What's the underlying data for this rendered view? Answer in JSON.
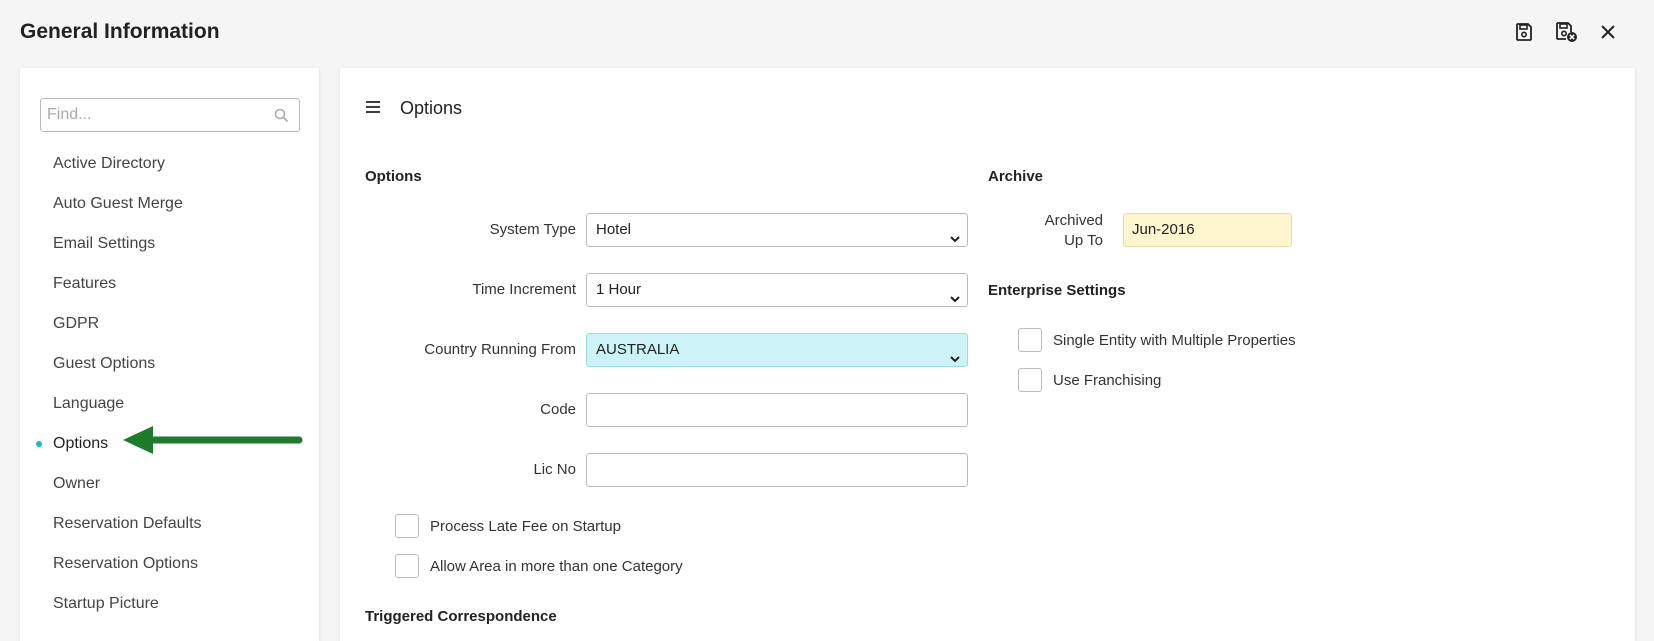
{
  "header": {
    "title": "General Information",
    "actions": [
      {
        "name": "save-icon"
      },
      {
        "name": "save-close-icon"
      },
      {
        "name": "close-icon"
      }
    ]
  },
  "sidebar": {
    "search_placeholder": "Find...",
    "items": [
      {
        "label": "Active Directory"
      },
      {
        "label": "Auto Guest Merge"
      },
      {
        "label": "Email Settings"
      },
      {
        "label": "Features"
      },
      {
        "label": "GDPR"
      },
      {
        "label": "Guest Options"
      },
      {
        "label": "Language"
      },
      {
        "label": "Options",
        "active": true
      },
      {
        "label": "Owner"
      },
      {
        "label": "Reservation Defaults"
      },
      {
        "label": "Reservation Options"
      },
      {
        "label": "Startup Picture"
      }
    ]
  },
  "main": {
    "title": "Options",
    "options_section": {
      "heading": "Options",
      "system_type": {
        "label": "System Type",
        "value": "Hotel"
      },
      "time_increment": {
        "label": "Time Increment",
        "value": "1 Hour"
      },
      "country": {
        "label": "Country Running From",
        "value": "AUSTRALIA"
      },
      "code": {
        "label": "Code",
        "value": ""
      },
      "lic_no": {
        "label": "Lic No",
        "value": ""
      },
      "process_late_fee": {
        "label": "Process Late Fee on Startup",
        "checked": false
      },
      "allow_area": {
        "label": "Allow Area in more than one Category",
        "checked": false
      }
    },
    "archive_section": {
      "heading": "Archive",
      "archived_up_to": {
        "label_line1": "Archived",
        "label_line2": "Up To",
        "value": "Jun-2016"
      }
    },
    "enterprise_section": {
      "heading": "Enterprise Settings",
      "single_entity": {
        "label": "Single Entity with Multiple Properties",
        "checked": false
      },
      "use_franchising": {
        "label": "Use Franchising",
        "checked": false
      }
    },
    "triggered_section": {
      "heading": "Triggered Correspondence"
    }
  },
  "colors": {
    "accent": "#1bb7c9",
    "arrow": "#1e7b2b",
    "highlight_cyan": "#cdf3f8",
    "highlight_yellow": "#fdf6cf"
  }
}
